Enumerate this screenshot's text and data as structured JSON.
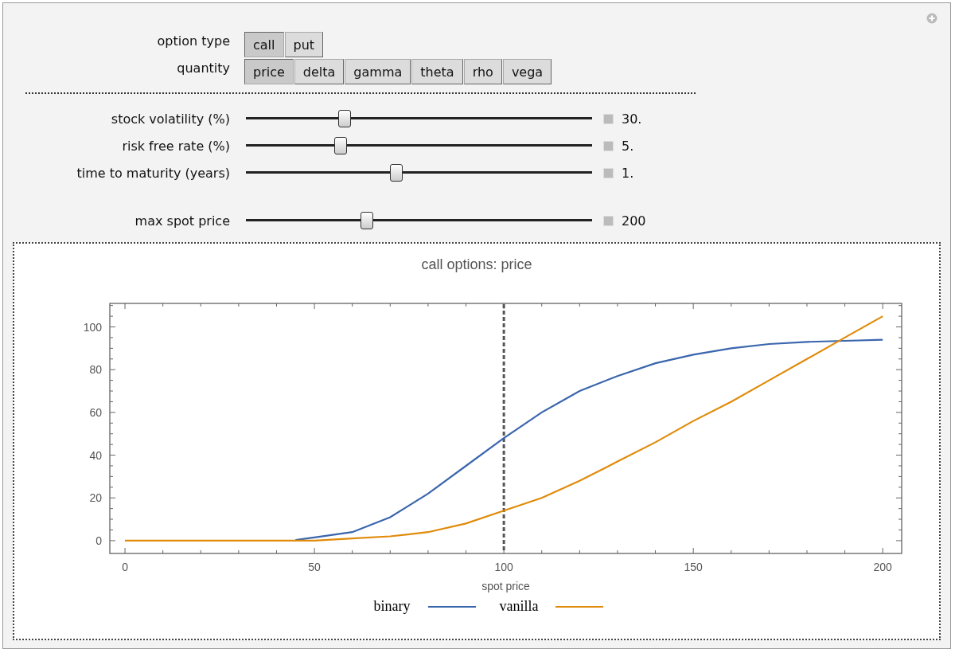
{
  "controls": [
    {
      "label": "option type",
      "kind": "buttons",
      "options": [
        {
          "label": "call",
          "selected": true
        },
        {
          "label": "put",
          "selected": false
        }
      ]
    },
    {
      "label": "quantity",
      "kind": "buttons",
      "options": [
        {
          "label": "price",
          "selected": true
        },
        {
          "label": "delta",
          "selected": false
        },
        {
          "label": "gamma",
          "selected": false
        },
        {
          "label": "theta",
          "selected": false
        },
        {
          "label": "rho",
          "selected": false
        },
        {
          "label": "vega",
          "selected": false
        }
      ]
    }
  ],
  "sliders": [
    {
      "label": "stock volatility (%)",
      "level": 0.285,
      "reading": "30."
    },
    {
      "label": "risk free rate (%)",
      "level": 0.273,
      "reading": "5."
    },
    {
      "label": "time to maturity (years)",
      "level": 0.435,
      "reading": "1."
    },
    {
      "label": "max spot price",
      "level": 0.35,
      "reading": "200"
    }
  ],
  "plot": {
    "chart_data": {
      "type": "line",
      "title": "call options: price",
      "xlabel": "spot price",
      "x": [
        0,
        10,
        20,
        30,
        40,
        45,
        50,
        60,
        70,
        80,
        90,
        100,
        110,
        120,
        130,
        140,
        150,
        160,
        170,
        180,
        190,
        200
      ],
      "series": [
        {
          "name": "binary",
          "color": "#3a66ad",
          "values": [
            null,
            null,
            null,
            null,
            null,
            0.3,
            1.5,
            4,
            11,
            22,
            35,
            48,
            60,
            70,
            77,
            83,
            87,
            90,
            92,
            93,
            93.5,
            94
          ]
        },
        {
          "name": "vanilla",
          "color": "#e08b0a",
          "values": [
            0,
            0,
            0,
            0,
            0,
            0,
            0,
            1,
            2,
            4,
            8,
            14,
            20,
            28,
            37,
            46,
            56,
            65,
            75,
            85,
            95,
            105
          ]
        }
      ],
      "xlim": [
        -4,
        205
      ],
      "ylim": [
        -6,
        111
      ],
      "xticks": [
        0,
        50,
        100,
        150,
        200
      ],
      "yticks": [
        0,
        20,
        40,
        60,
        80,
        100
      ],
      "ref_lines": [
        {
          "axis": "x",
          "value": 100
        }
      ]
    }
  }
}
